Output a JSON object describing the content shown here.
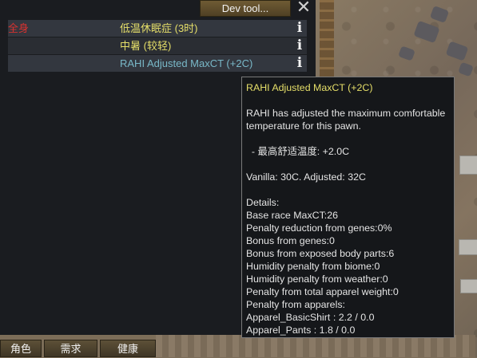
{
  "header": {
    "dev_tool_label": "Dev tool...",
    "close_label": "✕"
  },
  "health_rows": [
    {
      "part": "全身",
      "name": "低温休眠症 (3时)",
      "color": "#e6df69"
    },
    {
      "part": "",
      "name": "中暑 (较轻)",
      "color": "#e6df69"
    },
    {
      "part": "",
      "name": "RAHI Adjusted MaxCT (+2C)",
      "color": "#79b8c8"
    }
  ],
  "info_icon": "info-icon",
  "tooltip": {
    "title": "RAHI Adjusted MaxCT (+2C)",
    "description": "RAHI has adjusted the maximum comfortable temperature for this pawn.",
    "max_comfort_line": "  - 最高舒适温度: +2.0C",
    "vanilla_line": "Vanilla: 30C. Adjusted: 32C",
    "details_label": "Details:",
    "details": [
      "Base race MaxCT:26",
      "Penalty reduction from genes:0%",
      "Bonus from genes:0",
      "Bonus from exposed body parts:6",
      "Humidity penalty from biome:0",
      "Humidity penalty from weather:0",
      "Penalty from total apparel weight:0",
      "Penalty from apparels:",
      "Apparel_BasicShirt : 2.2 / 0.0",
      "Apparel_Pants : 1.8 / 0.0"
    ]
  },
  "bottom_tabs": [
    "角色",
    "需求",
    "健康"
  ]
}
